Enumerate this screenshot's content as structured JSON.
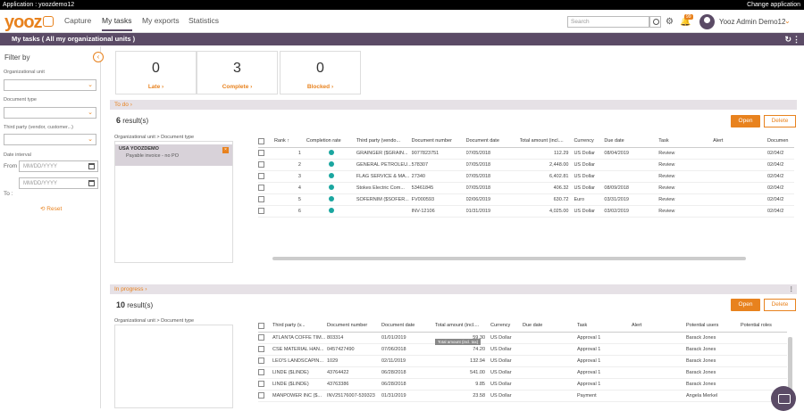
{
  "appbar": {
    "left": "Application : yoozdemo12",
    "right": "Change application"
  },
  "nav": {
    "logo": "yooz",
    "items": [
      "Capture",
      "My tasks",
      "My exports",
      "Statistics"
    ],
    "active": "My tasks",
    "search_placeholder": "Search",
    "notif_count": "99",
    "user_name": "Yooz Admin Demo12"
  },
  "page_title": "My tasks ( All my organizational units )",
  "filter": {
    "title": "Filter by",
    "org_unit_label": "Organizational unit",
    "doc_type_label": "Document type",
    "third_party_label": "Third party (vendor, customer...)",
    "date_interval_label": "Date interval",
    "from_label": "From",
    "to_label": "To :",
    "date_placeholder": "MM/DD/YYYY",
    "reset": "Reset"
  },
  "kpis": [
    {
      "value": "0",
      "label": "Late"
    },
    {
      "value": "3",
      "label": "Complete"
    },
    {
      "value": "0",
      "label": "Blocked"
    }
  ],
  "todo": {
    "section": "To do",
    "count": "6",
    "results_suffix": " result(s)",
    "open": "Open",
    "delete": "Delete",
    "ou_label": "Organizational unit > Document type",
    "ou_item": {
      "unit": "USA YOOZDEMO",
      "type": "Payable invoice - no PO"
    },
    "columns": [
      "Rank",
      "Completion rate",
      "Third party (vendo...",
      "Document number",
      "Document date",
      "Total amount (incl....",
      "Currency",
      "Due date",
      "Task",
      "Alert",
      "Documen"
    ],
    "rows": [
      [
        "1",
        "GRAINGER ($GRAIN...",
        "9077823751",
        "07/05/2018",
        "112.29",
        "US Dollar",
        "08/04/2019",
        "Review",
        "",
        "02/04/2"
      ],
      [
        "2",
        "GENERAL PETROLEU...",
        "578307",
        "07/05/2018",
        "2,448.00",
        "US Dollar",
        "",
        "Review",
        "",
        "02/04/2"
      ],
      [
        "3",
        "FLAG SERVICE & MA...",
        "27340",
        "07/05/2018",
        "6,402.81",
        "US Dollar",
        "",
        "Review",
        "",
        "02/04/2"
      ],
      [
        "4",
        "Stokes Electric Com...",
        "53461845",
        "07/05/2018",
        "406.32",
        "US Dollar",
        "08/09/2018",
        "Review",
        "",
        "02/04/2"
      ],
      [
        "5",
        "SOFERNIM ($SOFER...",
        "FV000593",
        "02/06/2019",
        "630.72",
        "Euro",
        "03/31/2019",
        "Review",
        "",
        "02/04/2"
      ],
      [
        "6",
        "",
        "INV-12106",
        "01/31/2019",
        "4,025.00",
        "US Dollar",
        "03/02/2019",
        "Review",
        "",
        "02/04/2"
      ]
    ]
  },
  "inprogress": {
    "section": "In progress",
    "count": "10",
    "results_suffix": " result(s)",
    "open": "Open",
    "delete": "Delete",
    "ou_label": "Organizational unit > Document type",
    "columns": [
      "Third party (v...",
      "Document number",
      "Document date",
      "Total amount (incl....",
      "Currency",
      "Due date",
      "Task",
      "Alert",
      "Potential users",
      "Potential roles"
    ],
    "tooltip": "Total amount (incl. tax)",
    "rows": [
      [
        "ATLANTA COFFE TIM...",
        "803314",
        "01/01/2019",
        "59.30",
        "US Dollar",
        "",
        "Approval 1",
        "",
        "Barack Jones",
        ""
      ],
      [
        "CSE MATERIAL HAN...",
        "0457427490",
        "07/06/2018",
        "74.20",
        "US Dollar",
        "",
        "Approval 1",
        "",
        "Barack Jones",
        ""
      ],
      [
        "LEO'S LANDSCAPIN...",
        "1029",
        "02/11/2019",
        "132.94",
        "US Dollar",
        "",
        "Approval 1",
        "",
        "Barack Jones",
        ""
      ],
      [
        "LINDE ($LINDE)",
        "43764422",
        "06/28/2018",
        "541.00",
        "US Dollar",
        "",
        "Approval 1",
        "",
        "Barack Jones",
        ""
      ],
      [
        "LINDE ($LINDE)",
        "43763386",
        "06/28/2018",
        "9.85",
        "US Dollar",
        "",
        "Approval 1",
        "",
        "Barack Jones",
        ""
      ],
      [
        "MANPOWER INC ($...",
        "INV25176007-539323",
        "01/31/2019",
        "23.58",
        "US Dollar",
        "",
        "Payment",
        "",
        "Angela Merkel",
        ""
      ]
    ]
  },
  "colors": {
    "accent": "#e8821e",
    "brand": "#5b4b66",
    "teal": "#1aa6a0"
  }
}
